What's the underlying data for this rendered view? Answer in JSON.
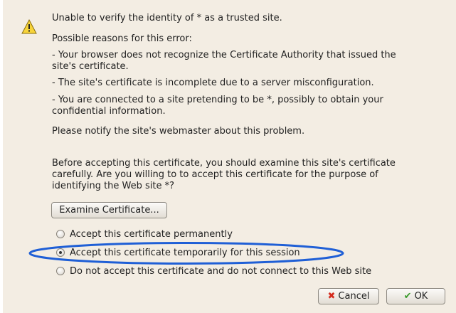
{
  "dialog": {
    "heading": "Unable to verify the identity of * as a trusted site.",
    "reasons_intro": "Possible reasons for this error:",
    "reason1_line1": "- Your browser does not recognize the Certificate Authority that issued the",
    "reason1_line2": "site's certificate.",
    "reason2": "- The site's certificate is incomplete due to a server misconfiguration.",
    "reason3_line1": "- You are connected to a site pretending to be *, possibly to obtain your",
    "reason3_line2": "confidential information.",
    "notify": "Please notify the site's webmaster about this problem.",
    "before_line1": "Before accepting this certificate, you should examine this site's certificate",
    "before_line2": "carefully. Are you willing to to accept this certificate for the purpose of",
    "before_line3": "identifying the Web site *?"
  },
  "buttons": {
    "examine_label": "Examine Certificate...",
    "cancel_label": "Cancel",
    "ok_label": "OK"
  },
  "options": {
    "permanent": "Accept this certificate permanently",
    "temporary": "Accept this certificate temporarily for this session",
    "reject": "Do not accept this certificate and do not connect to this Web site",
    "selected": "temporary"
  },
  "icons": {
    "warning": "warning-icon",
    "cancel": "red-x-icon",
    "ok": "green-check-icon"
  },
  "colors": {
    "dialog_bg": "#f3ede3",
    "highlight": "#1f5fd6",
    "warning_fill": "#f7d43a",
    "cancel_icon": "#d42b1e",
    "ok_icon": "#3a9a2a"
  }
}
